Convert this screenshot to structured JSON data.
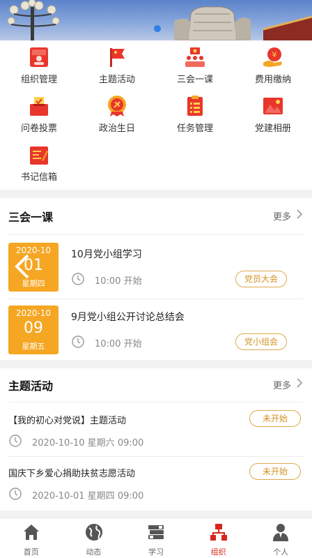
{
  "colors": {
    "accent_red": "#d7261d",
    "calendar_orange": "#f5a623",
    "pill_border": "#e0a84a"
  },
  "banner": {
    "carousel_index": 1,
    "carousel_total": 1
  },
  "grid": {
    "items": [
      {
        "label": "组织管理",
        "icon": "id-card-icon"
      },
      {
        "label": "主题活动",
        "icon": "flag-icon"
      },
      {
        "label": "三会一课",
        "icon": "meeting-icon"
      },
      {
        "label": "费用缴纳",
        "icon": "payment-icon"
      },
      {
        "label": "问卷投票",
        "icon": "vote-box-icon"
      },
      {
        "label": "政治生日",
        "icon": "party-badge-icon"
      },
      {
        "label": "任务管理",
        "icon": "task-list-icon"
      },
      {
        "label": "党建相册",
        "icon": "photo-album-icon"
      },
      {
        "label": "书记信箱",
        "icon": "mailbox-icon"
      }
    ]
  },
  "lessons": {
    "title": "三会一课",
    "more": "更多",
    "items": [
      {
        "year_month": "2020-10",
        "day": "01",
        "weekday": "星期四",
        "title": "10月党小组学习",
        "time": "10:00 开始",
        "tag": "党员大会"
      },
      {
        "year_month": "2020-10",
        "day": "09",
        "weekday": "星期五",
        "title": "9月党小组公开讨论总结会",
        "time": "10:00 开始",
        "tag": "党小组会"
      }
    ]
  },
  "activities": {
    "title": "主题活动",
    "more": "更多",
    "items": [
      {
        "title": "【我的初心对党说】主题活动",
        "datetime": "2020-10-10 星期六 09:00",
        "status": "未开始"
      },
      {
        "title": "国庆下乡爱心捐助扶贫志愿活动",
        "datetime": "2020-10-01 星期四 09:00",
        "status": "未开始"
      }
    ]
  },
  "tabbar": {
    "active": "组织",
    "items": [
      {
        "label": "首页",
        "icon": "home-icon"
      },
      {
        "label": "动态",
        "icon": "globe-icon"
      },
      {
        "label": "学习",
        "icon": "books-icon"
      },
      {
        "label": "组织",
        "icon": "organization-icon"
      },
      {
        "label": "个人",
        "icon": "person-icon"
      }
    ]
  }
}
